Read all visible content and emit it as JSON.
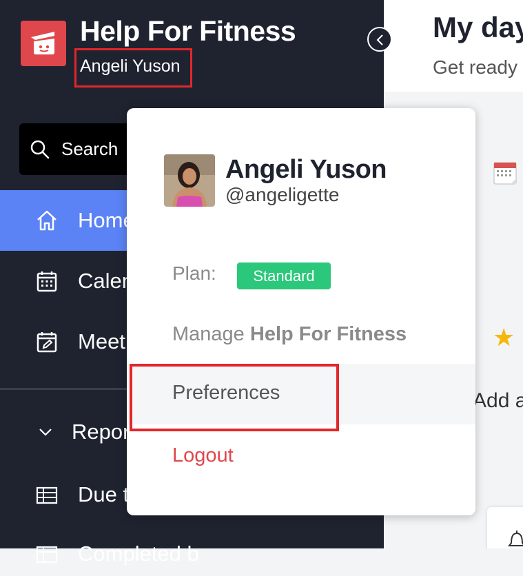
{
  "app": {
    "title": "Help For Fitness",
    "user_name": "Angeli Yuson"
  },
  "search": {
    "label": "Search"
  },
  "nav": [
    {
      "label": "Home",
      "icon": "home-icon",
      "active": true
    },
    {
      "label": "Calen",
      "icon": "calendar-icon"
    },
    {
      "label": "Meet",
      "icon": "meeting-icon"
    }
  ],
  "section": {
    "label": "Repor"
  },
  "sub_items": [
    {
      "label": "Due t",
      "icon": "table-icon"
    },
    {
      "label": "Completed b",
      "icon": "table-icon"
    }
  ],
  "main": {
    "title": "My day",
    "subtitle": "Get ready",
    "add_label": "Add a"
  },
  "popup": {
    "name": "Angeli Yuson",
    "handle": "@angeligette",
    "plan_label": "Plan:",
    "plan_value": "Standard",
    "manage_prefix": "Manage",
    "manage_app": "Help For Fitness",
    "preferences": "Preferences",
    "logout": "Logout"
  },
  "colors": {
    "sidebar_bg": "#1f2330",
    "active_nav": "#5b83f5",
    "logo_bg": "#e0474c",
    "badge_green": "#2bc77a",
    "logout_red": "#e0474c",
    "highlight_red": "#e3262b"
  }
}
